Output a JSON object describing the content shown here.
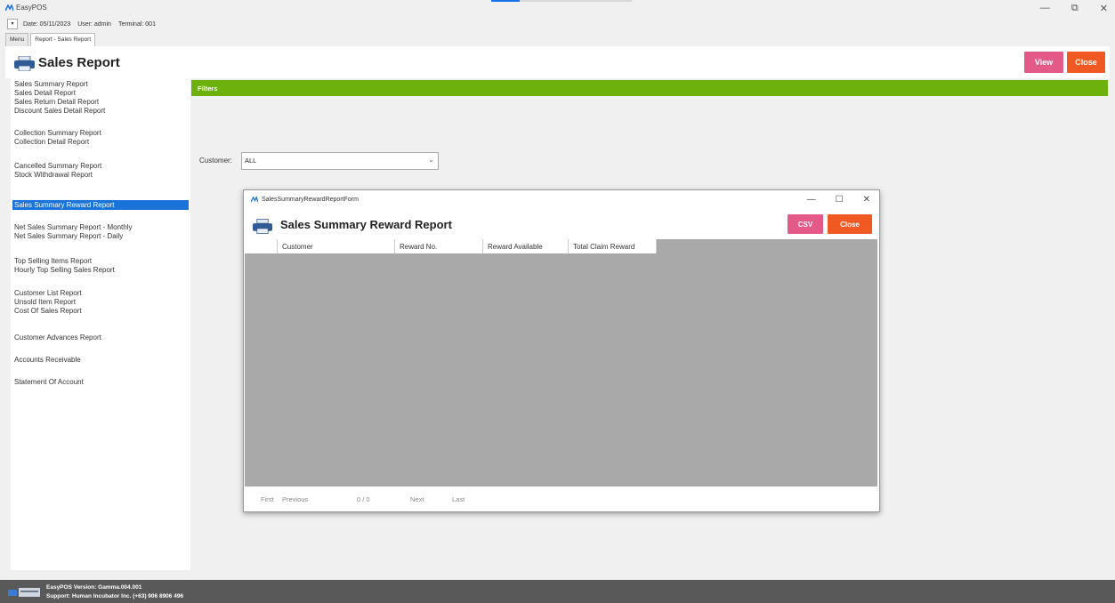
{
  "app": {
    "title": "EasyPOS",
    "progress_fraction": 0.2
  },
  "window_controls": {
    "minimize": "—",
    "restore": "⧉",
    "close": "✕"
  },
  "info": {
    "dropdown": "▾",
    "date": "Date: 05/11/2023",
    "user": "User: admin",
    "terminal": "Terminal: 001"
  },
  "tabs": [
    {
      "label": "Menu"
    },
    {
      "label": "Report - Sales Report"
    }
  ],
  "header": {
    "title": "Sales Report",
    "view_label": "View",
    "close_label": "Close"
  },
  "sidebar": {
    "items": [
      "Sales Summary Report",
      "Sales Detail Report",
      "Sales Return Detail Report",
      "Discount Sales Detail Report",
      "Collection Summary Report",
      "Collection Detail Report",
      "Cancelled Summary Report",
      "Stock Withdrawal Report",
      "Sales Summary Reward Report",
      "Net Sales Summary Report - Monthly",
      "Net Sales Summary Report - Daily",
      "Top Selling Items Report",
      "Hourly Top Selling Sales Report",
      "Customer List Report",
      "Unsold Item Report",
      "Cost Of Sales Report",
      "Customer Advances Report",
      "Accounts Receivable",
      "Statement Of Account"
    ],
    "selected": "Sales Summary Reward Report"
  },
  "filters": {
    "label": "Filters",
    "customer_label": "Customer:",
    "customer_value": "ALL"
  },
  "modal": {
    "window_title": "SalesSummaryRewardReportForm",
    "heading": "Sales Summary Reward Report",
    "csv_label": "CSV",
    "close_label": "Close",
    "controls": {
      "minimize": "—",
      "maximize": "☐",
      "close": "✕"
    },
    "columns": [
      "Customer",
      "Reward No.",
      "Reward Available",
      "Total Claim Reward"
    ],
    "pager": {
      "first": "First",
      "previous": "Previous",
      "page": "0 / 0",
      "next": "Next",
      "last": "Last"
    }
  },
  "footer": {
    "version": "EasyPOS Version: Gamma.004.001",
    "support": "Support: Human Incubator Inc. (+63) 906 8906 496"
  },
  "colors": {
    "accent_green": "#6cb10c",
    "view_pink": "#e35a88",
    "close_orange": "#f05a22",
    "selected_blue": "#1a73d9",
    "footer_gray": "#595959"
  }
}
